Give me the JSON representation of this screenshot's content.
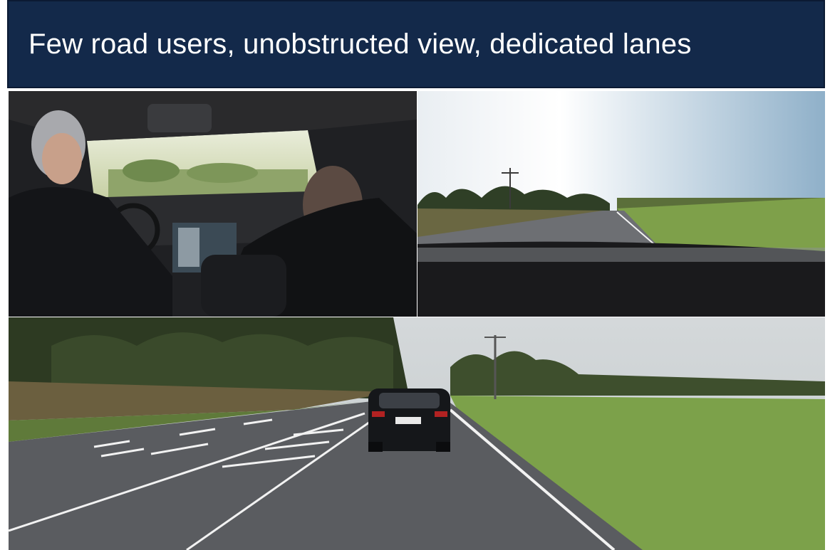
{
  "slide": {
    "title": "Few road users, unobstructed view, dedicated lanes"
  },
  "images": [
    {
      "name": "car-interior-photo"
    },
    {
      "name": "road-ahead-photo"
    },
    {
      "name": "following-car-photo"
    }
  ],
  "colors": {
    "title_bar": "#13294a",
    "title_text": "#ffffff"
  }
}
